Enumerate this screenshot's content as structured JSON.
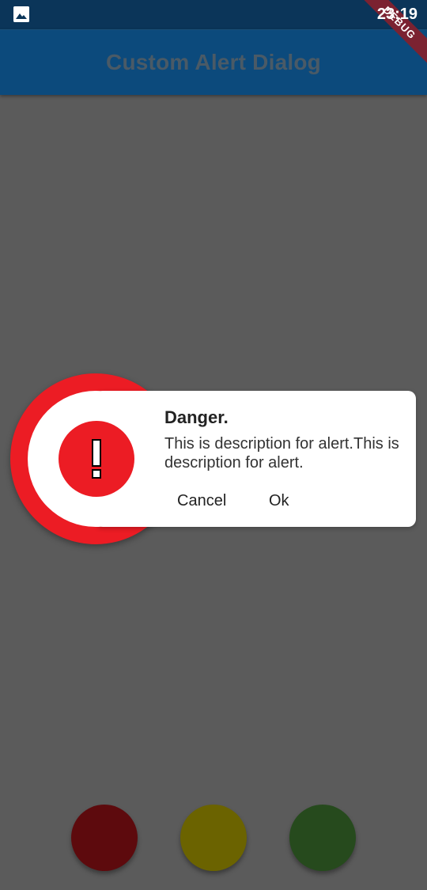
{
  "status_bar": {
    "time": "23:19",
    "image_icon": "image-icon"
  },
  "debug_banner": "DEBUG",
  "app_bar": {
    "title": "Custom Alert Dialog"
  },
  "dialog": {
    "icon": "exclamation-icon",
    "title": "Danger.",
    "description": "This is description for alert.This is description for alert.",
    "buttons": {
      "cancel": "Cancel",
      "ok": "Ok"
    },
    "accent_color": "#ec1c24"
  },
  "bottom_buttons": [
    {
      "name": "red-alert-button",
      "color": "#5d0a0d"
    },
    {
      "name": "yellow-alert-button",
      "color": "#6b6300"
    },
    {
      "name": "green-alert-button",
      "color": "#264a1d"
    }
  ]
}
